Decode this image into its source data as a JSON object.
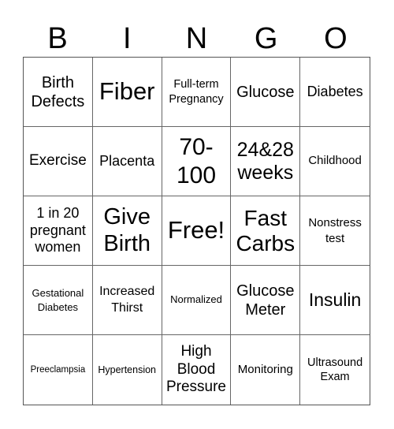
{
  "header": {
    "letters": [
      "B",
      "I",
      "N",
      "G",
      "O"
    ]
  },
  "card": {
    "cells": [
      "Birth Defects",
      "Fiber",
      "Full-term Pregnancy",
      "Glucose",
      "Diabetes",
      "Exercise",
      "Placenta",
      "70-100",
      "24&28 weeks",
      "Childhood",
      "1 in 20 pregnant women",
      "Give Birth",
      "Free!",
      "Fast Carbs",
      "Nonstress test",
      "Gestational Diabetes",
      "Increased Thirst",
      "Normalized",
      "Glucose Meter",
      "Insulin",
      "Preeclampsia",
      "Hypertension",
      "High Blood Pressure",
      "Monitoring",
      "Ultrasound Exam"
    ]
  }
}
